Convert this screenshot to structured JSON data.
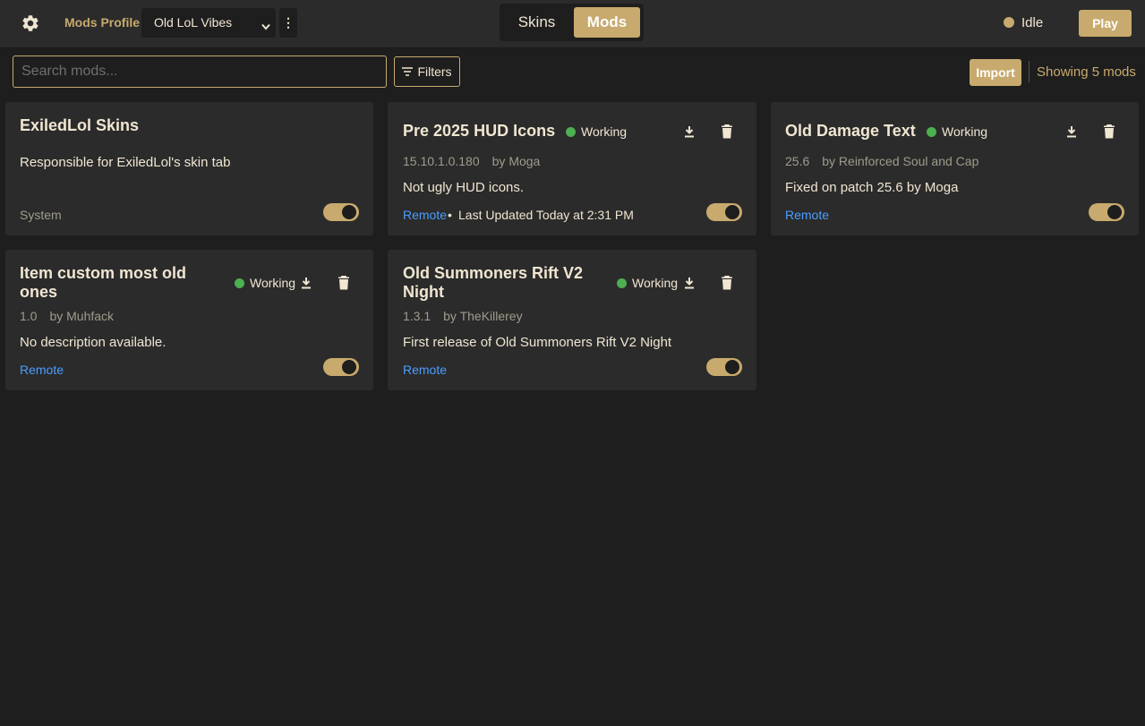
{
  "header": {
    "profile_label": "Mods Profile",
    "profile_value": "Old LoL Vibes",
    "tabs": [
      {
        "label": "Skins",
        "active": false
      },
      {
        "label": "Mods",
        "active": true
      }
    ],
    "status": "Idle",
    "play_label": "Play"
  },
  "toolbar": {
    "search_placeholder": "Search mods...",
    "filters_label": "Filters",
    "import_label": "Import",
    "showing_text": "Showing 5 mods"
  },
  "mods": [
    {
      "title": "ExiledLol Skins",
      "description": "Responsible for ExiledLol's skin tab",
      "source": "System",
      "enabled": true
    },
    {
      "title": "Pre 2025 HUD Icons",
      "status": "Working",
      "version": "15.10.1.0.180",
      "author": "by Moga",
      "description": "Not ugly HUD icons.",
      "source": "Remote",
      "separator": "•",
      "updated": "Last Updated Today at 2:31 PM",
      "enabled": true
    },
    {
      "title": "Old Damage Text",
      "status": "Working",
      "version": "25.6",
      "author": "by Reinforced Soul and Cap",
      "description": "Fixed on patch 25.6 by Moga",
      "source": "Remote",
      "enabled": true
    },
    {
      "title": "Item custom most old ones",
      "status": "Working",
      "version": "1.0",
      "author": "by Muhfack",
      "description": "No description available.",
      "source": "Remote",
      "enabled": true
    },
    {
      "title": "Old Summoners Rift V2 Night",
      "status": "Working",
      "version": "1.3.1",
      "author": "by TheKillerey",
      "description": "First release of Old Summoners Rift V2 Night",
      "source": "Remote",
      "enabled": true
    }
  ],
  "colors": {
    "accent": "#c8aa6e",
    "working": "#4caf50",
    "link": "#4a9eff",
    "background": "#1e1e1e",
    "card": "#2b2b2b"
  }
}
